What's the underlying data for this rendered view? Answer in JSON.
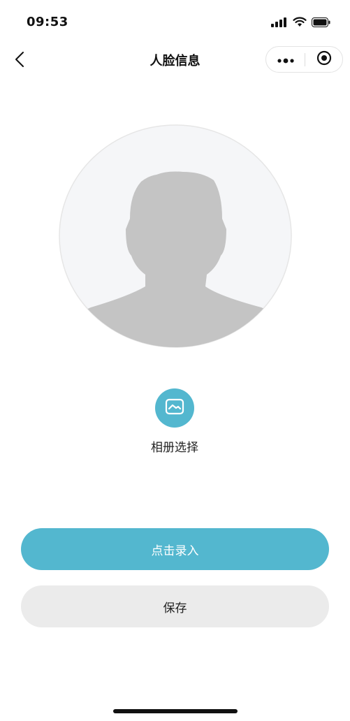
{
  "status_bar": {
    "time": "09:53",
    "signal_icon": "cellular-signal-icon",
    "wifi_icon": "wifi-icon",
    "battery_icon": "battery-icon"
  },
  "nav": {
    "back_icon": "chevron-left-icon",
    "title": "人脸信息",
    "more_icon": "more-dots-icon",
    "close_icon": "target-close-icon"
  },
  "avatar": {
    "icon": "person-silhouette-icon"
  },
  "album": {
    "icon": "image-icon",
    "label": "相册选择"
  },
  "actions": {
    "record_label": "点击录入",
    "save_label": "保存"
  },
  "colors": {
    "accent": "#53b7cf",
    "secondary_button": "#ebebeb",
    "avatar_bg": "#f5f6f8",
    "silhouette": "#c4c4c4"
  }
}
